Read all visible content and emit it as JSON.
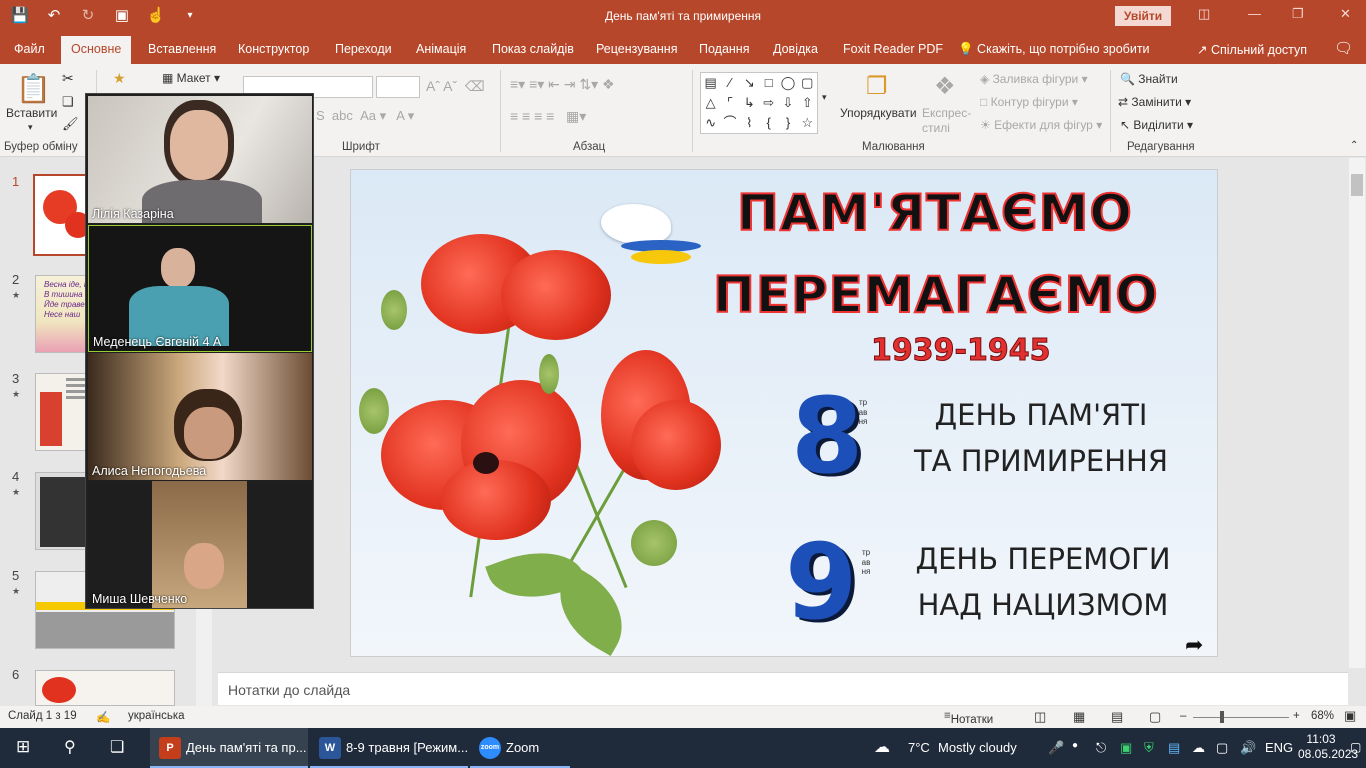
{
  "window": {
    "title": "День пам'яті та примирення",
    "signin_label": "Увійти"
  },
  "ribbon_tabs": [
    "Файл",
    "Основне",
    "Вставлення",
    "Конструктор",
    "Переходи",
    "Анімація",
    "Показ слайдів",
    "Рецензування",
    "Подання",
    "Довідка",
    "Foxit Reader PDF"
  ],
  "tell_me": "Скажіть, що потрібно зробити",
  "share_label": "Спільний доступ",
  "ribbon": {
    "paste": "Вставити",
    "clipboard_group": "Буфер обміну",
    "layout": "Макет",
    "font_group": "Шрифт",
    "paragraph_group": "Абзац",
    "drawing_group": "Малювання",
    "arrange": "Упорядкувати",
    "quick_styles": "Експрес-стилі",
    "shape_fill": "Заливка фігури",
    "shape_outline": "Контур фігури",
    "shape_effects": "Ефекти для фігур",
    "editing_group": "Редагування",
    "find": "Знайти",
    "replace": "Замінити",
    "select": "Виділити"
  },
  "thumbnails": [
    {
      "num": "1",
      "star": ""
    },
    {
      "num": "2",
      "star": "★"
    },
    {
      "num": "3",
      "star": "★"
    },
    {
      "num": "4",
      "star": "★"
    },
    {
      "num": "5",
      "star": "★"
    },
    {
      "num": "6",
      "star": ""
    }
  ],
  "thumb_texts": {
    "t2_l1": "Весна іде, к",
    "t2_l2": "В тишина",
    "t2_l3": "Йде травень т",
    "t2_l4": "Несе наш"
  },
  "slide": {
    "title1": "ПАМ'ЯТАЄМО",
    "title2": "ПЕРЕМАГАЄМО",
    "years": "1939-1945",
    "num1": "8",
    "month1": "травня",
    "day1_line1": "ДЕНЬ ПАМ'ЯТІ",
    "day1_line2": "ТА ПРИМИРЕННЯ",
    "num2": "9",
    "month2": "травня",
    "day2_line1": "ДЕНЬ ПЕРЕМОГИ",
    "day2_line2": "НАД НАЦИЗМОМ"
  },
  "zoom_participants": [
    "Лілія Казаріна",
    "Меденець Євгеній 4 А",
    "Алиса Непогодьева",
    "Миша Шевченко"
  ],
  "notes_placeholder": "Нотатки до слайда",
  "status": {
    "slide_info": "Слайд 1 з 19",
    "language": "українська",
    "notes": "Нотатки",
    "zoom": "68%"
  },
  "taskbar": {
    "app1": "День пам'яті та пр...",
    "app2": "8-9 травня [Режим...",
    "app3": "Zoom",
    "weather_temp": "7°C",
    "weather_desc": "Mostly cloudy",
    "lang": "ENG",
    "time": "11:03",
    "date": "08.05.2023"
  },
  "colors": {
    "accent": "#b7472a",
    "title_stroke": "#e33333",
    "number_blue": "#1d4fb8"
  }
}
